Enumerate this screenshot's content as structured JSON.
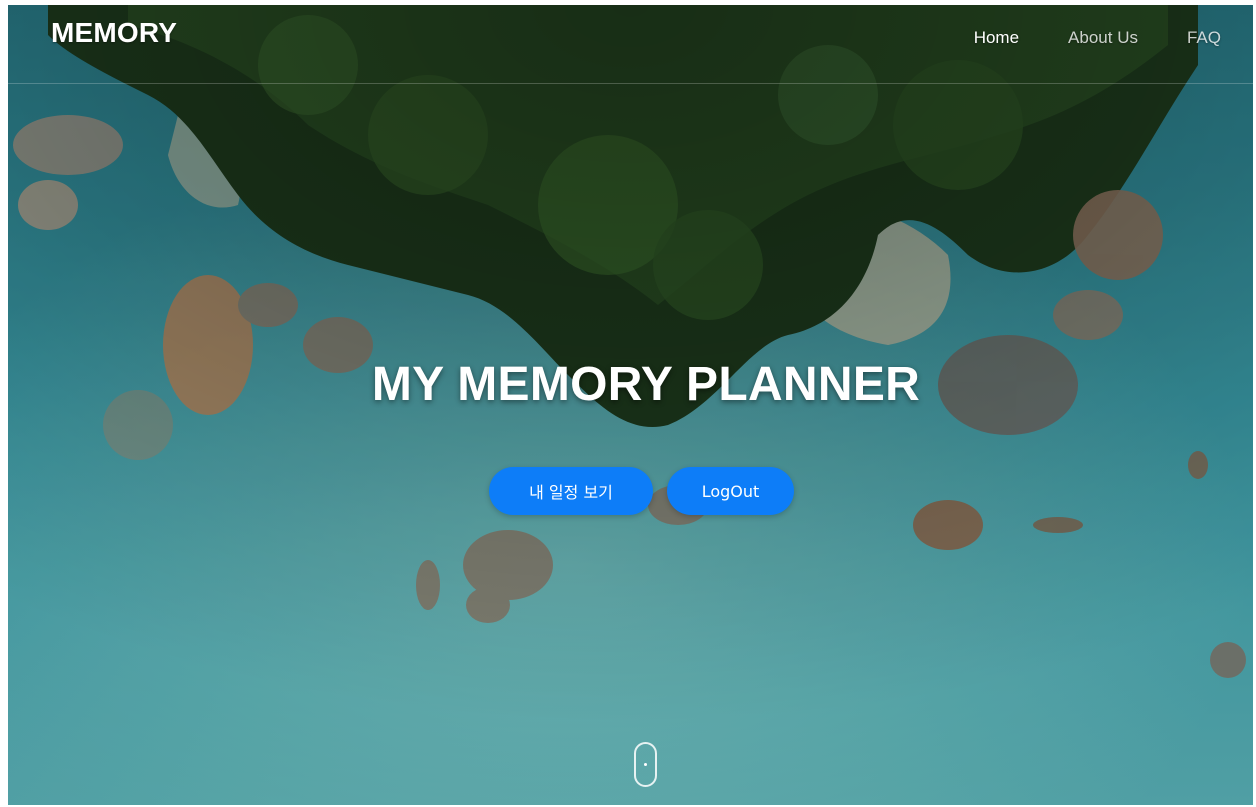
{
  "nav": {
    "brand": "MEMORY",
    "links": [
      {
        "label": "Home",
        "active": true
      },
      {
        "label": "About Us",
        "active": false
      },
      {
        "label": "FAQ",
        "active": false
      }
    ]
  },
  "hero": {
    "title": "MY MEMORY PLANNER",
    "buttons": {
      "schedule": "내 일정 보기",
      "logout": "LogOut"
    }
  },
  "colors": {
    "accent": "#0d7df8",
    "sea": "#2f8f9c",
    "forest": "#1f3a1c"
  },
  "icons": {
    "scroll": "mouse-scroll-icon"
  }
}
